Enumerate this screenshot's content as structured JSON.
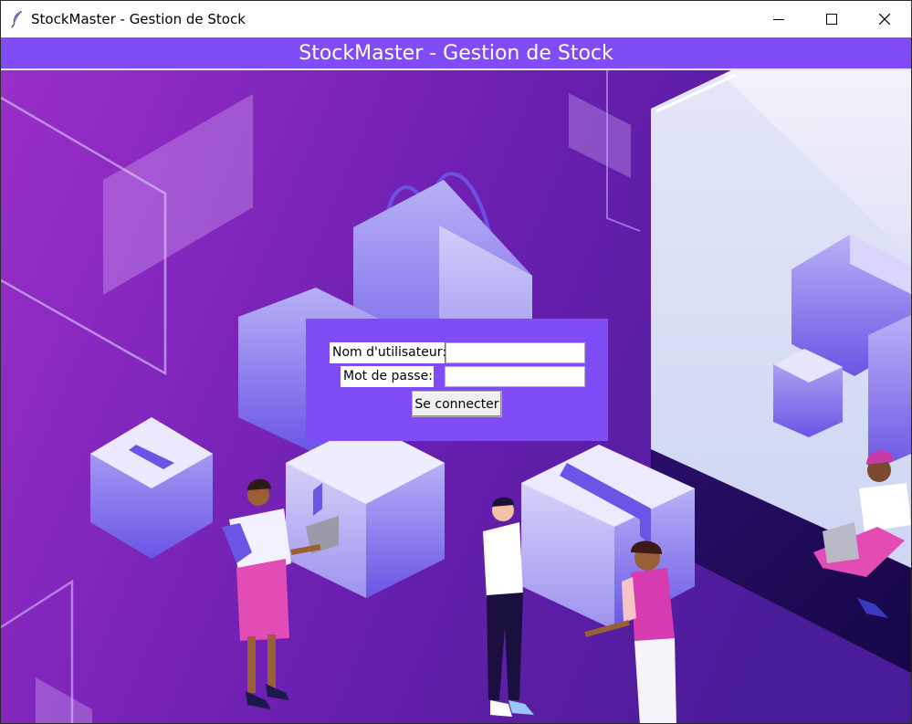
{
  "window": {
    "title": "StockMaster - Gestion de Stock",
    "icon": "feather-icon",
    "controls": [
      "minimize-icon",
      "maximize-icon",
      "close-icon"
    ]
  },
  "header": {
    "title": "StockMaster - Gestion de Stock",
    "background": "#7f4cf7"
  },
  "login": {
    "username_label": "Nom d'utilisateur:",
    "username_value": "",
    "password_label": "Mot de passe:",
    "password_value": "",
    "submit_label": "Se connecter"
  },
  "colors": {
    "accent": "#7f4cf7",
    "background_gradient": [
      "#9a2ec9",
      "#6b1fb0",
      "#4b1c9a"
    ]
  }
}
